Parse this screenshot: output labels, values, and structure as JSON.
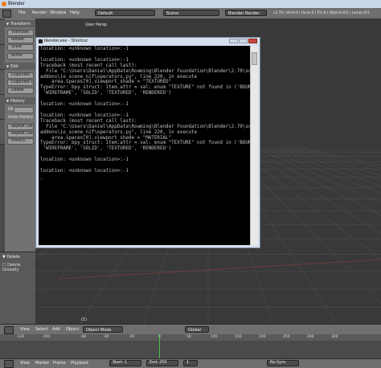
{
  "window": {
    "title": "Blender"
  },
  "info_header": {
    "menus": [
      "File",
      "Render",
      "Window",
      "Help"
    ],
    "layout_value": "Default",
    "scene_value": "Scene",
    "engine_value": "Blender Render",
    "stats": "v2.70 | Verts:0 | Faces:0 | Tris:0 | Objects:0/2 | Lamps:0/1"
  },
  "toolshelf": {
    "transform": {
      "title": "Transform",
      "buttons": [
        "Translate",
        "Rotate",
        "Scale",
        "Mirror"
      ]
    },
    "edit": {
      "title": "Edit",
      "buttons": [
        "Duplicate",
        "Duplicate Linked",
        "Delete"
      ]
    },
    "history": {
      "title": "History",
      "labels": [
        "Undo",
        "Undo History"
      ],
      "buttons": [
        "Repeat Last",
        "Repeat Last",
        "History..."
      ]
    }
  },
  "operator_panel": {
    "title": "Delete",
    "option": "Delete Globally"
  },
  "viewport": {
    "label": "User Persp",
    "frame_label": "(1)"
  },
  "console": {
    "title": "blender.exe - Shortcut",
    "text": "location: <unknown location>:-1\n\nlocation: <unknown location>:-1\nTraceback (most recent call last):\n  File \"C:\\Users\\Daniel\\AppData\\Roaming\\Blender Foundation\\Blender\\2.70\\scripts\\\naddons\\io_scene_nif\\operators.py\", line 220, in execute\n    area.spaces[0].viewport_shade = \"TEXTURED\"\nTypeError: bpy_struct: item.attr = val: enum \"TEXTURE\" not found in ('BOUNDBOX',\n 'WIREFRAME', 'SOLID', 'TEXTURED', 'RENDERED')\n\nlocation: <unknown location>:-1\n\nlocation: <unknown location>:-1\nTraceback (most recent call last):\n  File \"C:\\Users\\Daniel\\AppData\\Roaming\\Blender Foundation\\Blender\\2.70\\scripts\\\naddons\\io_scene_nif\\operators.py\", line 220, in execute\n    area.spaces[0].viewport_shade = \"MATERIAL\"\nTypeError: bpy_struct: item.attr = val: enum \"TEXTURE\" not found in ('BOUNDBOX',\n 'WIREFRAME', 'SOLID', 'TEXTURED', 'RENDERED')\n\nlocation: <unknown location>:-1\n\nlocation: <unknown location>:-1\n_"
  },
  "view3d_header": {
    "menus": [
      "View",
      "Select",
      "Add",
      "Object"
    ],
    "mode_value": "Object Mode",
    "pivot_value": "Global"
  },
  "timeline": {
    "ticks": [
      "-120",
      "-100",
      "-60",
      "-40",
      "-20",
      "0",
      "50",
      "100",
      "150",
      "200",
      "250",
      "280",
      "300"
    ],
    "menus": [
      "View",
      "Marker",
      "Frame",
      "Playback"
    ],
    "start_label": "Start: 1",
    "end_label": "End: 250",
    "current": "1",
    "sync_value": "No Sync"
  },
  "colors": {
    "viewport_bg": "#393939",
    "console_bg": "#000000",
    "accent": "#e87d0d"
  }
}
